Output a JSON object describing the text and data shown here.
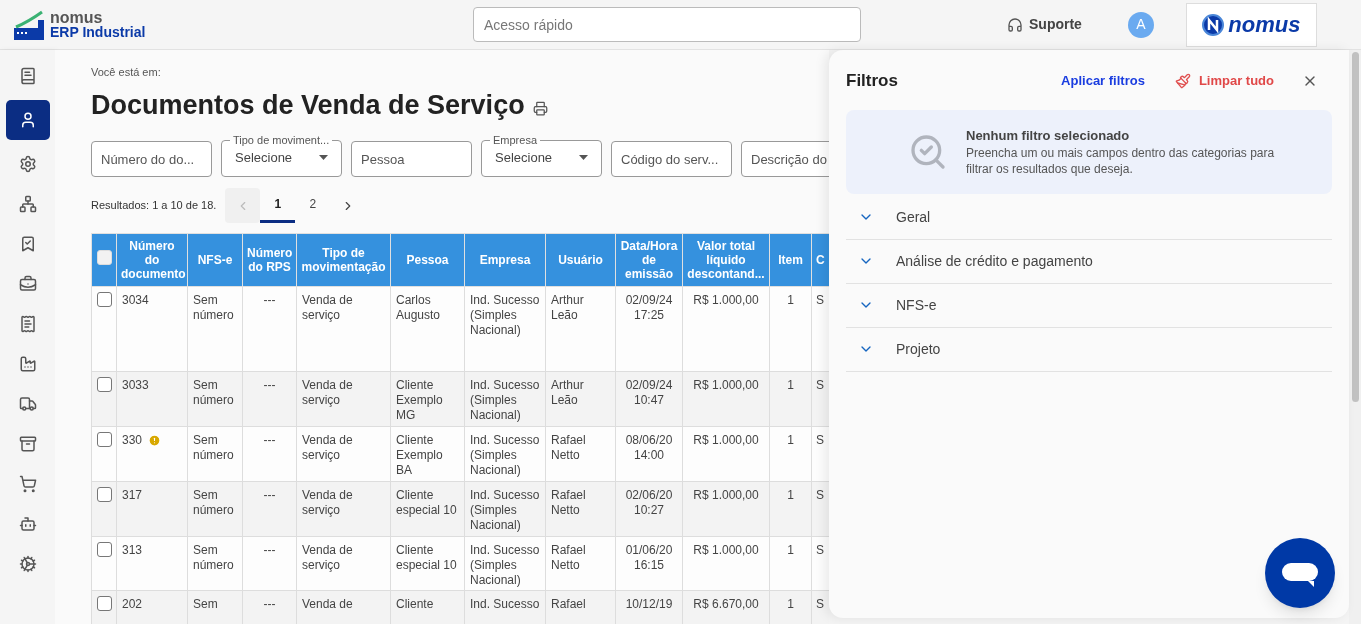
{
  "header": {
    "logo": {
      "brand": "nomus",
      "product": "ERP Industrial"
    },
    "search": {
      "placeholder": "Acesso rápido"
    },
    "support": "Suporte",
    "avatar": "A",
    "partner_logo": "nomus"
  },
  "sidebar": {
    "items": [
      {
        "selected": false
      },
      {
        "selected": true
      },
      {
        "selected": false
      },
      {
        "selected": false
      },
      {
        "selected": false
      },
      {
        "selected": false
      },
      {
        "selected": false
      },
      {
        "selected": false
      },
      {
        "selected": false
      },
      {
        "selected": false
      },
      {
        "selected": false
      },
      {
        "selected": false
      },
      {
        "selected": false
      }
    ]
  },
  "breadcrumb": "Você está em:",
  "title": "Documentos de Venda de Serviço",
  "filters": [
    {
      "kind": "text",
      "placeholder": "Número do do..."
    },
    {
      "kind": "select",
      "label": "Tipo de moviment...",
      "value": "Selecione"
    },
    {
      "kind": "text",
      "placeholder": "Pessoa"
    },
    {
      "kind": "select",
      "label": "Empresa",
      "value": "Selecione"
    },
    {
      "kind": "text",
      "placeholder": "Código do serv..."
    },
    {
      "kind": "text",
      "placeholder": "Descrição do"
    }
  ],
  "results": "Resultados: 1 a 10 de 18.",
  "pagination": {
    "prev_disabled": true,
    "pages": [
      {
        "label": "1",
        "selected": true
      },
      {
        "label": "2",
        "selected": false
      }
    ]
  },
  "table": {
    "select_all_checked": false,
    "columns": [
      "Número do documento",
      "NFS-e",
      "Número do RPS",
      "Tipo de movimentação",
      "Pessoa",
      "Empresa",
      "Usuário",
      "Data/Hora de emissão",
      "Valor total líquido descontand...",
      "Item",
      "C"
    ],
    "rows": [
      {
        "checked": false,
        "warning": false,
        "cells": [
          "3034",
          "Sem número",
          "---",
          "Venda de serviço",
          "Carlos Augusto",
          "Ind. Sucesso (Simples Nacional)",
          "Arthur Leão",
          "02/09/24 17:25",
          "R$ 1.000,00",
          "1",
          "S"
        ]
      },
      {
        "checked": false,
        "warning": false,
        "cells": [
          "3033",
          "Sem número",
          "---",
          "Venda de serviço",
          "Cliente Exemplo MG",
          "Ind. Sucesso (Simples Nacional)",
          "Arthur Leão",
          "02/09/24 10:47",
          "R$ 1.000,00",
          "1",
          "S"
        ]
      },
      {
        "checked": false,
        "warning": true,
        "cells": [
          "330",
          "Sem número",
          "---",
          "Venda de serviço",
          "Cliente Exemplo BA",
          "Ind. Sucesso (Simples Nacional)",
          "Rafael Netto",
          "08/06/20 14:00",
          "R$ 1.000,00",
          "1",
          "S"
        ]
      },
      {
        "checked": false,
        "warning": false,
        "cells": [
          "317",
          "Sem número",
          "---",
          "Venda de serviço",
          "Cliente especial 10",
          "Ind. Sucesso (Simples Nacional)",
          "Rafael Netto",
          "02/06/20 10:27",
          "R$ 1.000,00",
          "1",
          "S"
        ]
      },
      {
        "checked": false,
        "warning": false,
        "cells": [
          "313",
          "Sem número",
          "---",
          "Venda de serviço",
          "Cliente especial 10",
          "Ind. Sucesso (Simples Nacional)",
          "Rafael Netto",
          "01/06/20 16:15",
          "R$ 1.000,00",
          "1",
          "S"
        ]
      },
      {
        "checked": false,
        "warning": false,
        "cells": [
          "202",
          "Sem",
          "---",
          "Venda de",
          "Cliente",
          "Ind. Sucesso",
          "Rafael",
          "10/12/19",
          "R$ 6.670,00",
          "1",
          "S"
        ]
      }
    ]
  },
  "filter_panel": {
    "title": "Filtros",
    "apply": "Aplicar filtros",
    "clear": "Limpar tudo",
    "empty": {
      "title": "Nenhum filtro selecionado",
      "text": "Preencha um ou mais campos dentro das categorias para filtrar os resultados que deseja."
    },
    "sections": [
      {
        "label": "Geral",
        "expanded": false
      },
      {
        "label": "Análise de crédito e pagamento",
        "expanded": false
      },
      {
        "label": "NFS-e",
        "expanded": false
      },
      {
        "label": "Projeto",
        "expanded": false
      }
    ]
  }
}
